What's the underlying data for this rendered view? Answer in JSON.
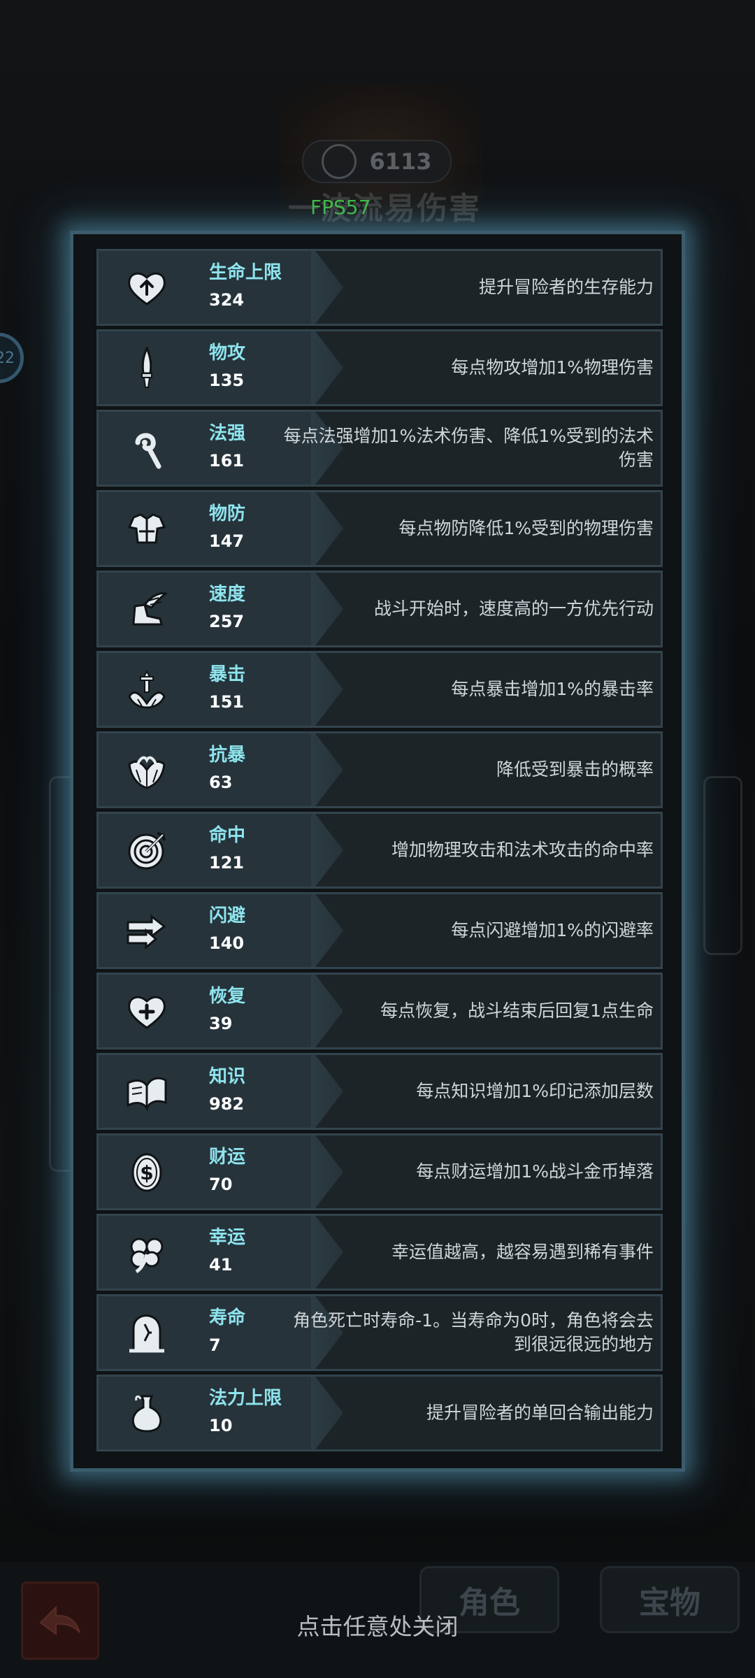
{
  "fps_label": "FPS57",
  "background": {
    "score": "6113",
    "title": "一波流易伤害",
    "level_badge": "22",
    "tabs": [
      "角色",
      "宝物"
    ]
  },
  "close_hint": "点击任意处关闭",
  "colors": {
    "name": "#8ee4ee",
    "value": "#ffffff",
    "desc": "#cfd6da",
    "panel_glow": "#508ca5",
    "fps": "#42c242"
  },
  "stats": [
    {
      "icon": "heart-up-icon",
      "name": "生命上限",
      "value": "324",
      "desc": "提升冒险者的生存能力"
    },
    {
      "icon": "dagger-icon",
      "name": "物攻",
      "value": "135",
      "desc": "每点物攻增加1%物理伤害"
    },
    {
      "icon": "staff-icon",
      "name": "法强",
      "value": "161",
      "desc": "每点法强增加1%法术伤害、降低1%受到的法术伤害"
    },
    {
      "icon": "armor-icon",
      "name": "物防",
      "value": "147",
      "desc": "每点物防降低1%受到的物理伤害"
    },
    {
      "icon": "winged-boot-icon",
      "name": "速度",
      "value": "257",
      "desc": "战斗开始时，速度高的一方优先行动"
    },
    {
      "icon": "crit-sword-icon",
      "name": "暴击",
      "value": "151",
      "desc": "每点暴击增加1%的暴击率"
    },
    {
      "icon": "crit-shield-icon",
      "name": "抗暴",
      "value": "63",
      "desc": "降低受到暴击的概率"
    },
    {
      "icon": "target-icon",
      "name": "命中",
      "value": "121",
      "desc": "增加物理攻击和法术攻击的命中率"
    },
    {
      "icon": "dodge-arrows-icon",
      "name": "闪避",
      "value": "140",
      "desc": "每点闪避增加1%的闪避率"
    },
    {
      "icon": "heart-plus-icon",
      "name": "恢复",
      "value": "39",
      "desc": "每点恢复，战斗结束后回复1点生命"
    },
    {
      "icon": "book-icon",
      "name": "知识",
      "value": "982",
      "desc": "每点知识增加1%印记添加层数"
    },
    {
      "icon": "coin-icon",
      "name": "财运",
      "value": "70",
      "desc": "每点财运增加1%战斗金币掉落"
    },
    {
      "icon": "clover-icon",
      "name": "幸运",
      "value": "41",
      "desc": "幸运值越高，越容易遇到稀有事件"
    },
    {
      "icon": "tombstone-icon",
      "name": "寿命",
      "value": "7",
      "desc": "角色死亡时寿命-1。当寿命为0时，角色将会去到很远很远的地方"
    },
    {
      "icon": "mana-flask-icon",
      "name": "法力上限",
      "value": "10",
      "desc": "提升冒险者的单回合输出能力"
    }
  ]
}
